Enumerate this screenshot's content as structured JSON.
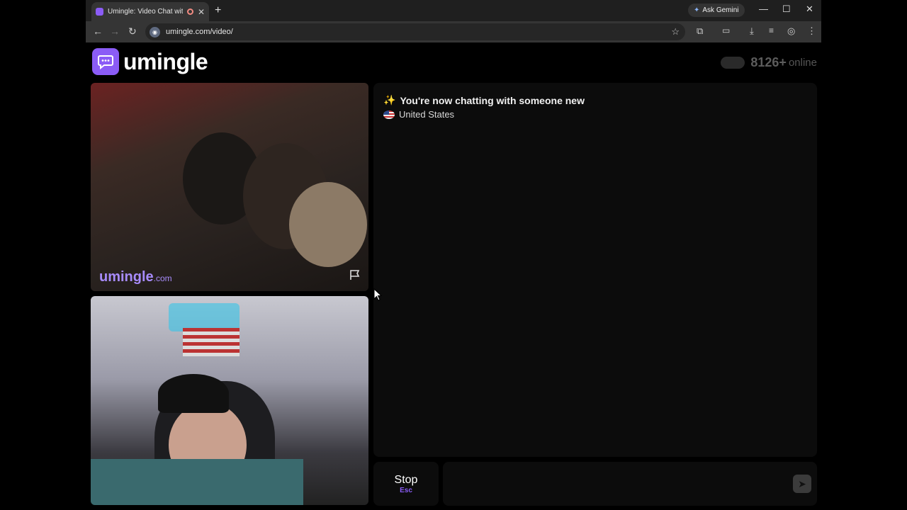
{
  "browser": {
    "tab_title": "Umingle: Video Chat with S",
    "tab_close": "✕",
    "new_tab": "+",
    "gemini_label": "Ask Gemini",
    "url": "umingle.com/video/",
    "minimize": "—",
    "maximize": "☐",
    "close": "✕"
  },
  "header": {
    "logo_text": "umingle",
    "online_count": "8126+",
    "online_label": "online"
  },
  "video": {
    "watermark": "umingle",
    "watermark_suffix": ".com"
  },
  "chat": {
    "status_icon": "✨",
    "status_message": "You're now chatting with someone new",
    "country": "United States"
  },
  "controls": {
    "stop_label": "Stop",
    "stop_key": "Esc"
  },
  "colors": {
    "brand": "#8b5cf6",
    "background": "#000000",
    "panel": "#0c0c0c"
  }
}
